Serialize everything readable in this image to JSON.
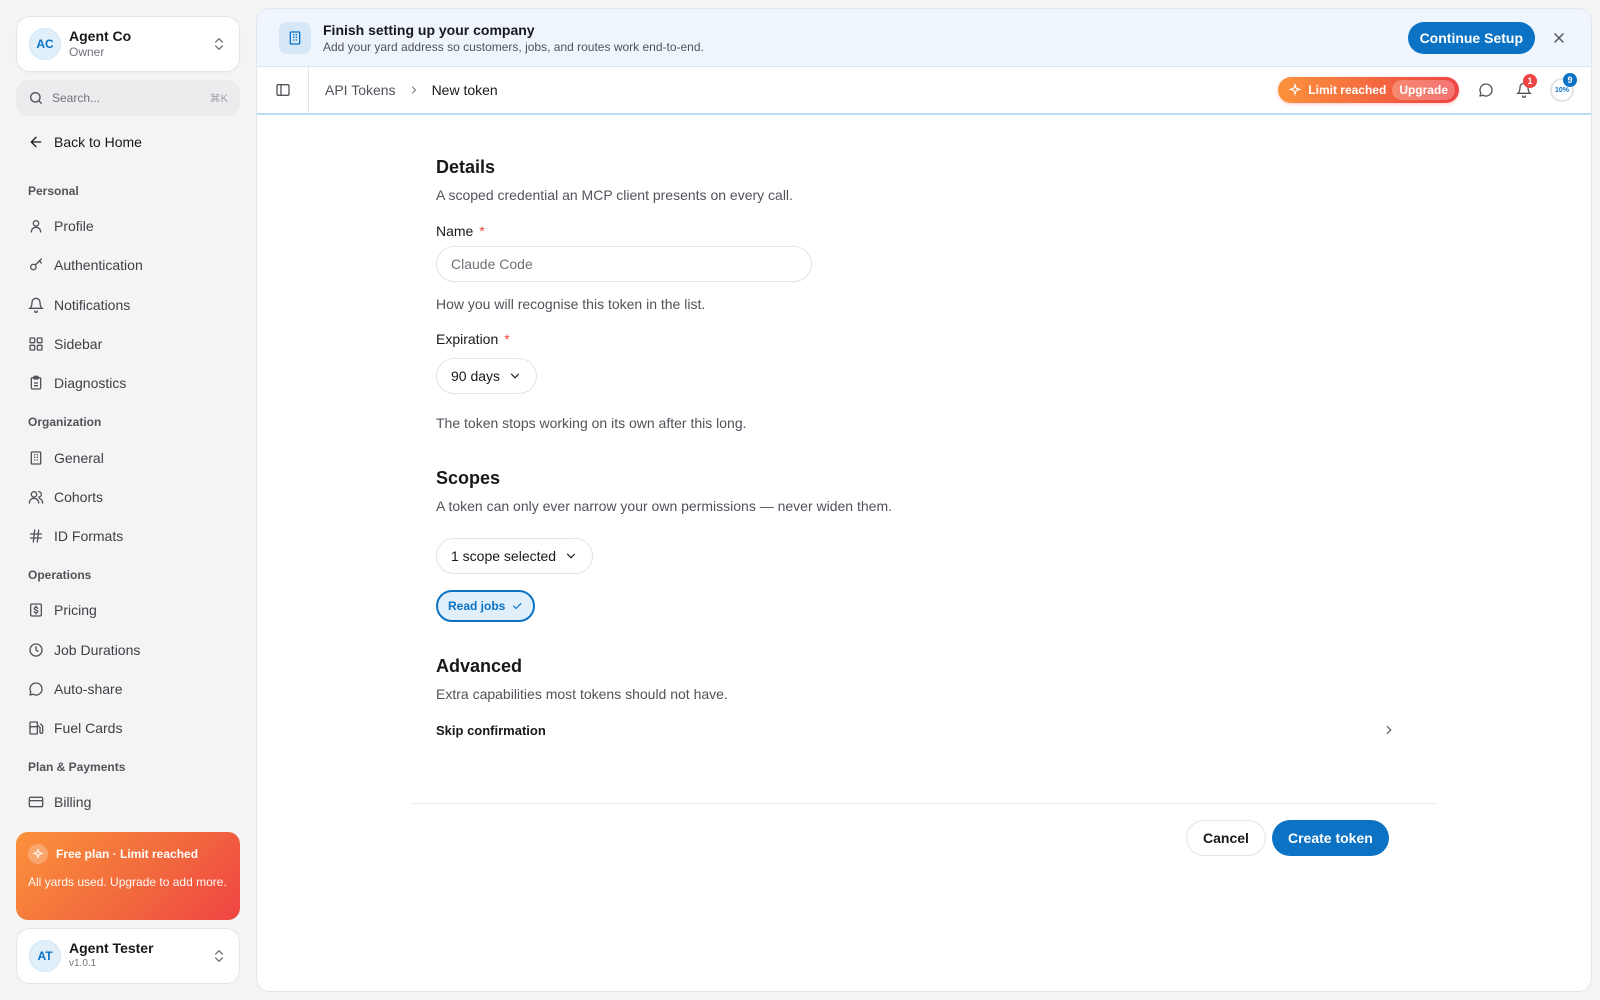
{
  "org": {
    "initials": "AC",
    "name": "Agent Co",
    "role": "Owner"
  },
  "search": {
    "label": "Search...",
    "shortcut": "⌘K"
  },
  "nav": {
    "back_home": "Back to Home",
    "groups": {
      "personal": "Personal",
      "organization": "Organization",
      "operations": "Operations",
      "plan_payments": "Plan & Payments"
    },
    "items": {
      "profile": "Profile",
      "authentication": "Authentication",
      "notifications": "Notifications",
      "sidebar": "Sidebar",
      "diagnostics": "Diagnostics",
      "general": "General",
      "cohorts": "Cohorts",
      "id_formats": "ID Formats",
      "pricing": "Pricing",
      "job_durations": "Job Durations",
      "auto_share": "Auto-share",
      "fuel_cards": "Fuel Cards",
      "billing": "Billing"
    }
  },
  "plan_card": {
    "title": "Free plan · Limit reached",
    "description": "All yards used. Upgrade to add more."
  },
  "user": {
    "initials": "AT",
    "name": "Agent Tester",
    "version": "v1.0.1"
  },
  "banner": {
    "title": "Finish setting up your company",
    "subtitle": "Add your yard address so customers, jobs, and routes work end-to-end.",
    "cta": "Continue Setup"
  },
  "breadcrumb": {
    "parent": "API Tokens",
    "current": "New token"
  },
  "topbar": {
    "limit_label": "Limit reached",
    "upgrade_label": "Upgrade",
    "notification_count": "1",
    "progress_badge": "9",
    "progress_label": "10%"
  },
  "form": {
    "details": {
      "title": "Details",
      "description": "A scoped credential an MCP client presents on every call."
    },
    "name": {
      "label": "Name",
      "required": "*",
      "placeholder": "Claude Code",
      "help": "How you will recognise this token in the list."
    },
    "expiration": {
      "label": "Expiration",
      "required": "*",
      "value": "90 days",
      "help": "The token stops working on its own after this long."
    },
    "scopes": {
      "title": "Scopes",
      "description": "A token can only ever narrow your own permissions — never widen them.",
      "selector_value": "1 scope selected",
      "selected": [
        "Read jobs"
      ]
    },
    "advanced": {
      "title": "Advanced",
      "description": "Extra capabilities most tokens should not have.",
      "row_label": "Skip confirmation"
    },
    "actions": {
      "cancel": "Cancel",
      "submit": "Create token"
    }
  }
}
